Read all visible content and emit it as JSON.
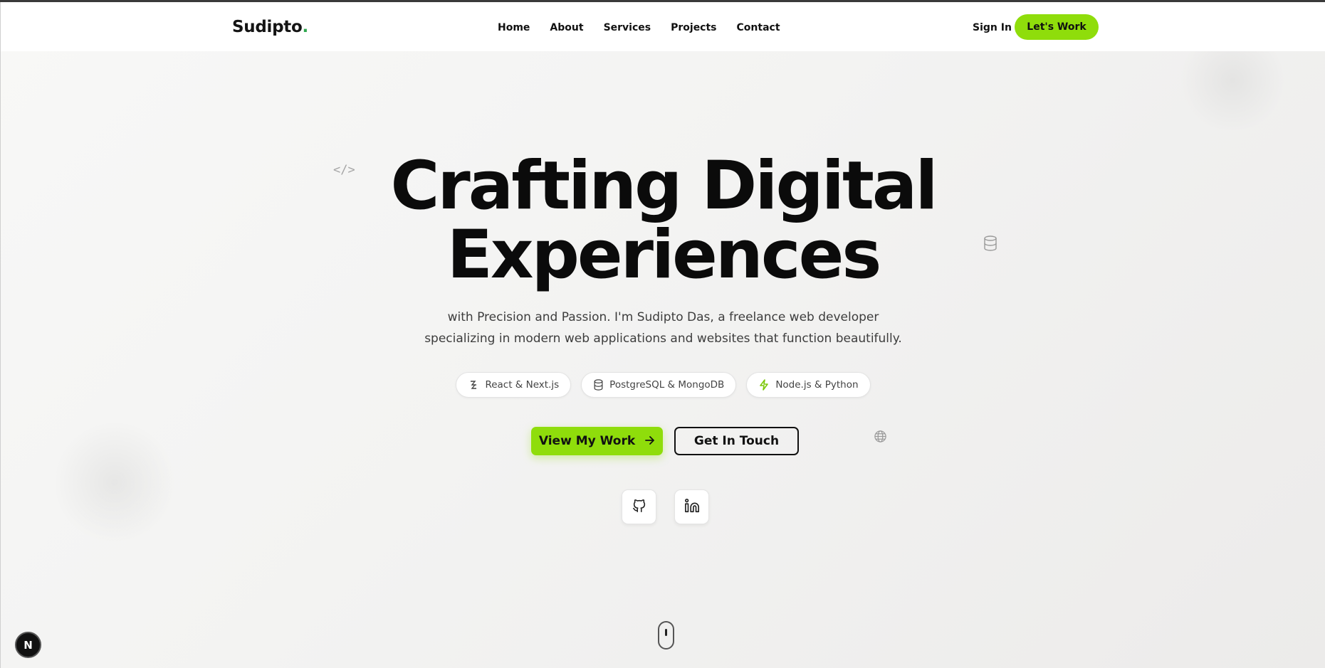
{
  "nav": {
    "logo_text": "Sudipto",
    "logo_dot": ".",
    "links": [
      "Home",
      "About",
      "Services",
      "Projects",
      "Contact"
    ],
    "signin_label": "Sign In",
    "cta_label": "Let's Work"
  },
  "hero": {
    "title_line1": "Crafting Digital",
    "title_line2": "Experiences",
    "subtitle_line1": "with Precision and Passion. I'm Sudipto Das, a freelance web developer",
    "subtitle_line2": "specializing in modern web applications and websites that function beautifully.",
    "pills": [
      {
        "icon": "react-icon",
        "label": "React & Next.js"
      },
      {
        "icon": "database-icon",
        "label": "PostgreSQL & MongoDB"
      },
      {
        "icon": "lightning-icon",
        "label": "Node.js & Python"
      }
    ],
    "primary_button": "View My Work",
    "secondary_button": "Get In Touch",
    "socials": [
      "github-icon",
      "linkedin-icon"
    ]
  },
  "decor": {
    "code_symbol": "</>",
    "next_badge": "N"
  },
  "colors": {
    "accent": "#8fdd0b",
    "logo_dot": "#2fa84f",
    "text": "#0b0b0b"
  }
}
